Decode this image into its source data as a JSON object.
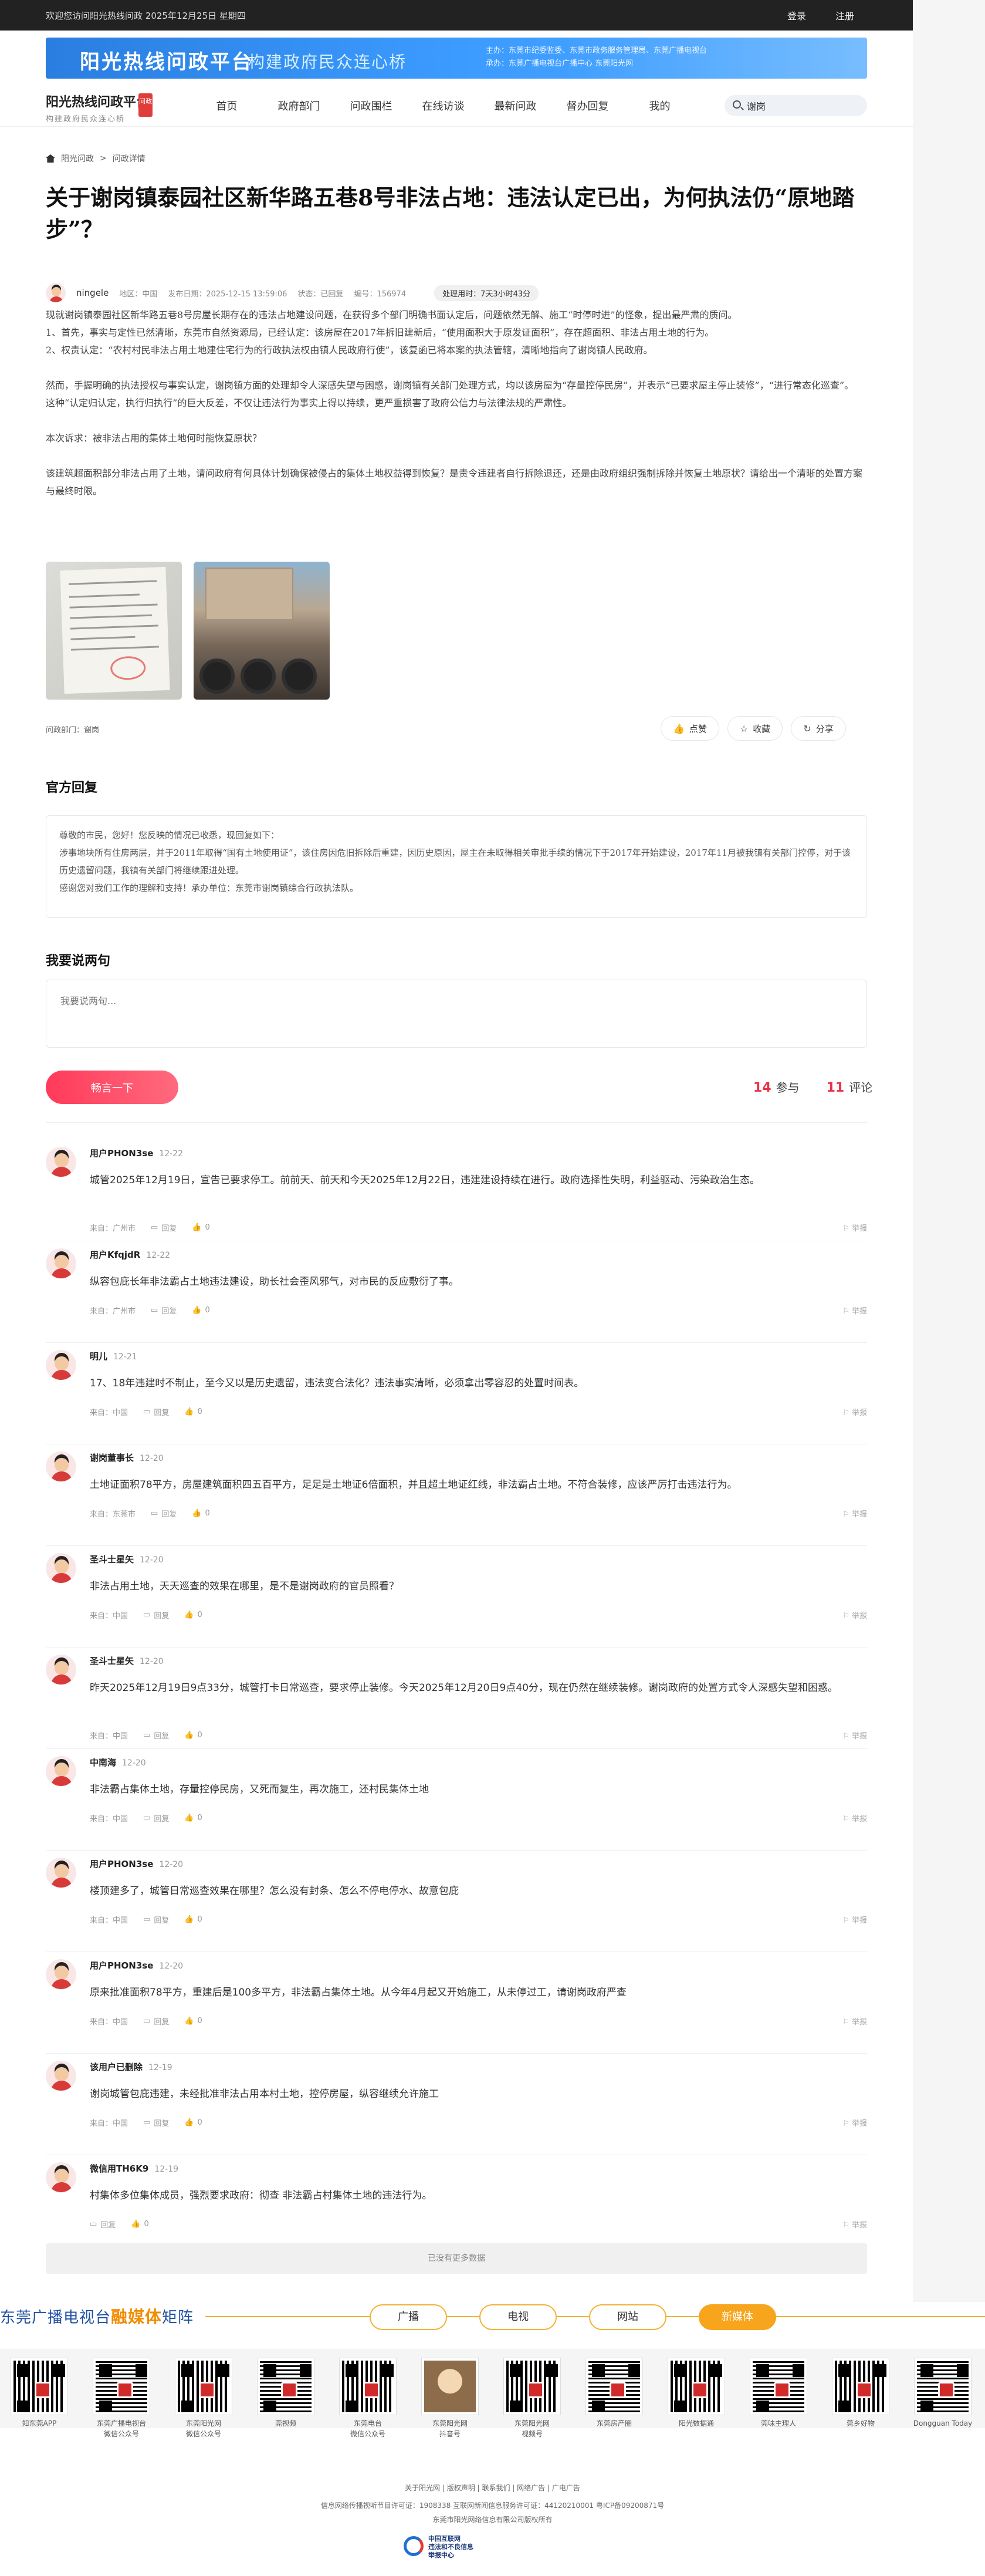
{
  "topbar": {
    "welcome": "欢迎您访问阳光热线问政  2025年12月25日 星期四",
    "login": "登录",
    "register": "注册"
  },
  "banner": {
    "title": "阳光热线问政平台",
    "slogan": "构建政府民众连心桥",
    "info_line1": "主办：东莞市纪委监委、东莞市政务服务管理局、东莞广播电视台",
    "info_line2": "承办：东莞广播电视台广播中心 东莞阳光网"
  },
  "nav": {
    "logo_title": "阳光热线问政平台",
    "logo_sub": "构建政府民众连心桥",
    "logo_tag": "问政",
    "menu": [
      "首页",
      "政府部门",
      "问政围栏",
      "在线访谈",
      "最新问政",
      "督办回复",
      "我的"
    ],
    "search_value": "谢岗"
  },
  "breadcrumb": {
    "home": "阳光问政",
    "separator": ">",
    "current": "问政详情"
  },
  "article": {
    "title": "关于谢岗镇泰园社区新华路五巷8号非法占地：违法认定已出，为何执法仍“原地踏步”？",
    "author": "ningele",
    "region": "地区：中国",
    "time": "发布日期：2025-12-15 13:59:06",
    "status": "状态：已回复",
    "number": "编号：156974",
    "duration": "处理用时：7天3小时43分",
    "paragraphs": [
      "现就谢岗镇泰园社区新华路五巷8号房屋长期存在的违法占地建设问题，在获得多个部门明确书面认定后，问题依然无解、施工“时停时进”的怪象，提出最严肃的质问。",
      "1、首先，事实与定性已然清晰，东莞市自然资源局，已经认定：该房屋在2017年拆旧建新后，“使用面积大于原发证面积”，存在超面积、非法占用土地的行为。",
      "2、权责认定：“农村村民非法占用土地建住宅行为的行政执法权由镇人民政府行使”，该复函已将本案的执法管辖，清晰地指向了谢岗镇人民政府。"
    ],
    "paragraphs2": [
      "然而，手握明确的执法授权与事实认定，谢岗镇方面的处理却令人深感失望与困惑，谢岗镇有关部门处理方式，均以该房屋为“存量控停民房”，并表示“已要求屋主停止装修”，“进行常态化巡查”。",
      "这种“认定归认定，执行归执行”的巨大反差，不仅让违法行为事实上得以持续，更严重损害了政府公信力与法律法规的严肃性。"
    ],
    "question1": "本次诉求：被非法占用的集体土地何时能恢复原状？",
    "question2": "该建筑超面积部分非法占用了土地，请问政府有何具体计划确保被侵占的集体土地权益得到恢复？是责令违建者自行拆除退还，还是由政府组织强制拆除并恢复土地原状？请给出一个清晰的处置方案与最终时限。",
    "photo1_alt": "东莞市自然资源局复函",
    "photo2_alt": "现场施工照片",
    "dept": "问政部门：谢岗",
    "actions": {
      "like": "点赞",
      "favorite": "收藏",
      "share": "分享"
    }
  },
  "official_reply": {
    "heading": "官方回复",
    "lines": [
      "尊敬的市民，您好！您反映的情况已收悉，现回复如下：",
      "涉事地块所有住房两层，并于2011年取得“国有土地使用证”，该住房因危旧拆除后重建，因历史原因，屋主在未取得相关审批手续的情况下于2017年开始建设，2017年11月被我镇有关部门控停，对于该历史遗留问题，我镇有关部门将继续跟进处理。",
      "感谢您对我们工作的理解和支持！承办单位：东莞市谢岗镇综合行政执法队。"
    ]
  },
  "comment_box": {
    "heading": "我要说两句",
    "placeholder": "我要说两句...",
    "submit": "畅言一下",
    "participants": "14",
    "participants_label": "参与",
    "comments_count": "11",
    "comments_label": "评论"
  },
  "comments": [
    {
      "user": "用户PHON3se",
      "date": "12-22",
      "text": "城管2025年12月19日，宣告已要求停工。前前天、前天和今天2025年12月22日，违建建设持续在进行。政府选择性失明，利益驱动、污染政治生态。",
      "from": "来自：广州市",
      "reply": "回复",
      "likes": "0",
      "report": "举报"
    },
    {
      "user": "用户KfqjdR",
      "date": "12-22",
      "text": "纵容包庇长年非法霸占土地违法建设，助长社会歪风邪气，对市民的反应敷衍了事。",
      "from": "来自：广州市",
      "reply": "回复",
      "likes": "0",
      "report": "举报"
    },
    {
      "user": "明儿",
      "date": "12-21",
      "text": "17、18年违建时不制止，至今又以是历史遗留，违法变合法化？违法事实清晰，必须拿出零容忍的处置时间表。",
      "from": "来自：中国",
      "reply": "回复",
      "likes": "0",
      "report": "举报"
    },
    {
      "user": "谢岗董事长",
      "date": "12-20",
      "text": "土地证面积78平方，房屋建筑面积四五百平方，足足是土地证6倍面积，并且超土地证红线，非法霸占土地。不符合装修，应该严厉打击违法行为。",
      "from": "来自：东莞市",
      "reply": "回复",
      "likes": "0",
      "report": "举报"
    },
    {
      "user": "圣斗士星矢",
      "date": "12-20",
      "text": "非法占用土地，天天巡查的效果在哪里，是不是谢岗政府的官员照看？",
      "from": "来自：中国",
      "reply": "回复",
      "likes": "0",
      "report": "举报"
    },
    {
      "user": "圣斗士星矢",
      "date": "12-20",
      "text": "昨天2025年12月19日9点33分，城管打卡日常巡查，要求停止装修。今天2025年12月20日9点40分，现在仍然在继续装修。谢岗政府的处置方式令人深感失望和困惑。",
      "from": "来自：中国",
      "reply": "回复",
      "likes": "0",
      "report": "举报"
    },
    {
      "user": "中南海",
      "date": "12-20",
      "text": "非法霸占集体土地，存量控停民房，又死而复生，再次施工，还村民集体土地",
      "from": "来自：中国",
      "reply": "回复",
      "likes": "0",
      "report": "举报"
    },
    {
      "user": "用户PHON3se",
      "date": "12-20",
      "text": "楼顶建多了，城管日常巡查效果在哪里？怎么没有封条、怎么不停电停水、故意包庇",
      "from": "来自：中国",
      "reply": "回复",
      "likes": "0",
      "report": "举报"
    },
    {
      "user": "用户PHON3se",
      "date": "12-20",
      "text": "原来批准面积78平方，重建后是100多平方，非法霸占集体土地。从今年4月起又开始施工，从未停过工，请谢岗政府严查",
      "from": "来自：中国",
      "reply": "回复",
      "likes": "0",
      "report": "举报"
    },
    {
      "user": "该用户已删除",
      "date": "12-19",
      "text": "谢岗城管包庇违建，未经批准非法占用本村土地，控停房屋，纵容继续允许施工",
      "from": "来自：中国",
      "reply": "回复",
      "likes": "0",
      "report": "举报"
    },
    {
      "user": "微信用TH6K9",
      "date": "12-19",
      "text": "村集体多位集体成员，强烈要求政府：彻查 非法霸占村集体土地的违法行为。",
      "from": "",
      "reply": "回复",
      "likes": "0",
      "report": "举报"
    }
  ],
  "load_more": "已没有更多数据",
  "matrix": {
    "title_prefix": "东莞广播电视台",
    "title_highlight": "融媒体",
    "title_suffix": "矩阵",
    "tabs": [
      "广播",
      "电视",
      "网站",
      "新媒体"
    ],
    "active_tab": "新媒体",
    "items": [
      {
        "label": "知东莞APP",
        "label2": ""
      },
      {
        "label": "东莞广播电视台",
        "label2": "微信公众号"
      },
      {
        "label": "东莞阳光网",
        "label2": "微信公众号"
      },
      {
        "label": "莞视频",
        "label2": ""
      },
      {
        "label": "东莞电台",
        "label2": "微信公众号"
      },
      {
        "label": "东莞阳光网",
        "label2": "抖音号"
      },
      {
        "label": "东莞阳光网",
        "label2": "视频号"
      },
      {
        "label": "东莞房产圈",
        "label2": ""
      },
      {
        "label": "阳光数据通",
        "label2": ""
      },
      {
        "label": "莞味主理人",
        "label2": ""
      },
      {
        "label": "莞乡好物",
        "label2": ""
      },
      {
        "label": "Dongguan Today",
        "label2": ""
      }
    ]
  },
  "footer": {
    "links": "关于阳光网 | 版权声明 | 联系我们 | 网络广告 | 广电广告",
    "license": "信息网络传播视听节目许可证：1908338 互联网新闻信息服务许可证：44120210001 粤ICP备09200871号",
    "institution": "东莞市阳光网络信息有限公司版权所有",
    "seal_text1": "中国互联网",
    "seal_text2": "违法和不良信息举报中心"
  },
  "colors": {
    "accent": "#e8324a",
    "banner_blue": "#2a7ee0",
    "matrix_orange": "#f7a51c",
    "matrix_blue": "#1e50a2"
  }
}
